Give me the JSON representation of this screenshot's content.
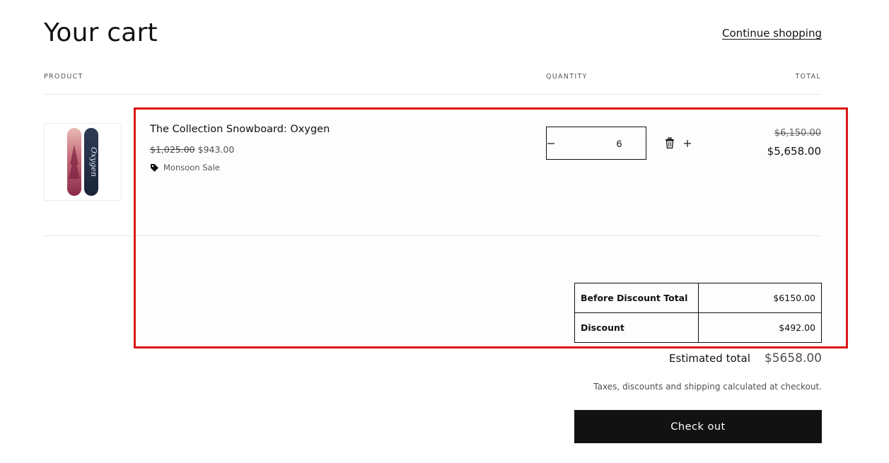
{
  "header": {
    "title": "Your cart",
    "continue_label": "Continue shopping"
  },
  "columns": {
    "product": "PRODUCT",
    "quantity": "QUANTITY",
    "total": "TOTAL"
  },
  "cart_items": [
    {
      "name": "The Collection Snowboard: Oxygen",
      "compare_price": "$1,025.00",
      "price": "$943.00",
      "discount_name": "Monsoon Sale",
      "quantity": "6",
      "line_total_original": "$6,150.00",
      "line_total": "$5,658.00",
      "image_text": "Oxygen"
    }
  ],
  "summary": {
    "rows": [
      {
        "label": "Before Discount Total",
        "value": "$6150.00"
      },
      {
        "label": "Discount",
        "value": "$492.00"
      }
    ],
    "estimated_label": "Estimated total",
    "estimated_value": "$5658.00",
    "tax_note": "Taxes, discounts and shipping calculated at checkout.",
    "checkout_label": "Check out"
  },
  "colors": {
    "highlight": "#dc1818",
    "button_bg": "#121212",
    "text": "#121212"
  },
  "icons": {
    "minus": "minus-icon",
    "plus": "plus-icon",
    "delete": "trash-icon",
    "tag": "tag-icon"
  }
}
